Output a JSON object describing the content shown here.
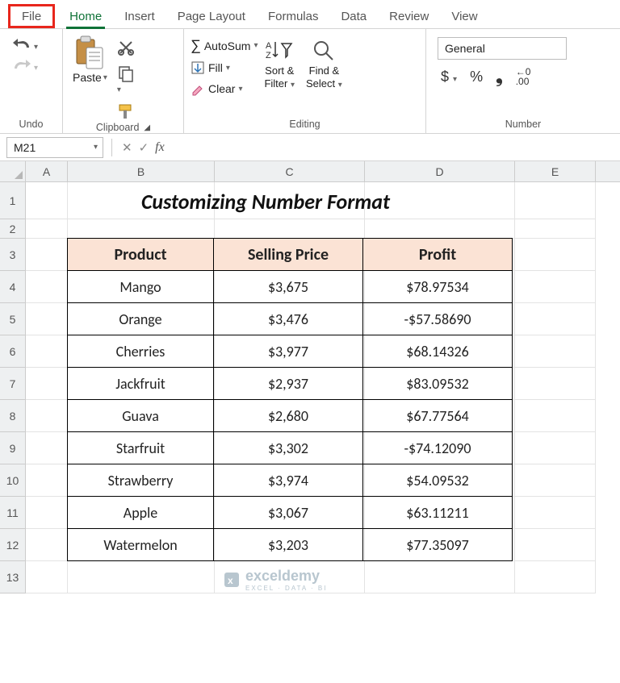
{
  "tabs": {
    "file": "File",
    "home": "Home",
    "insert": "Insert",
    "page_layout": "Page Layout",
    "formulas": "Formulas",
    "data": "Data",
    "review": "Review",
    "view": "View"
  },
  "ribbon": {
    "undo_group": "Undo",
    "clipboard_group": "Clipboard",
    "paste": "Paste",
    "editing_group": "Editing",
    "autosum": "AutoSum",
    "fill": "Fill",
    "clear": "Clear",
    "sort_filter_l1": "Sort &",
    "sort_filter_l2": "Filter",
    "find_select_l1": "Find &",
    "find_select_l2": "Select",
    "number_group": "Number",
    "number_format": "General",
    "currency": "$",
    "percent": "%",
    "comma": ",",
    "inc_dec": "←0\n.00"
  },
  "fbar": {
    "namebox": "M21",
    "fx": "fx",
    "formula": ""
  },
  "cols": [
    "A",
    "B",
    "C",
    "D",
    "E"
  ],
  "row_nums": [
    "1",
    "2",
    "3",
    "4",
    "5",
    "6",
    "7",
    "8",
    "9",
    "10",
    "11",
    "12",
    "13"
  ],
  "title": "Customizing Number Format",
  "table": {
    "headers": [
      "Product",
      "Selling Price",
      "Profit"
    ],
    "rows": [
      [
        "Mango",
        "$3,675",
        "$78.97534"
      ],
      [
        "Orange",
        "$3,476",
        "-$57.58690"
      ],
      [
        "Cherries",
        "$3,977",
        "$68.14326"
      ],
      [
        "Jackfruit",
        "$2,937",
        "$83.09532"
      ],
      [
        "Guava",
        "$2,680",
        "$67.77564"
      ],
      [
        "Starfruit",
        "$3,302",
        "-$74.12090"
      ],
      [
        "Strawberry",
        "$3,974",
        "$54.09532"
      ],
      [
        "Apple",
        "$3,067",
        "$63.11211"
      ],
      [
        "Watermelon",
        "$3,203",
        "$77.35097"
      ]
    ]
  },
  "watermark": {
    "brand": "exceldemy",
    "tag": "EXCEL · DATA · BI"
  }
}
